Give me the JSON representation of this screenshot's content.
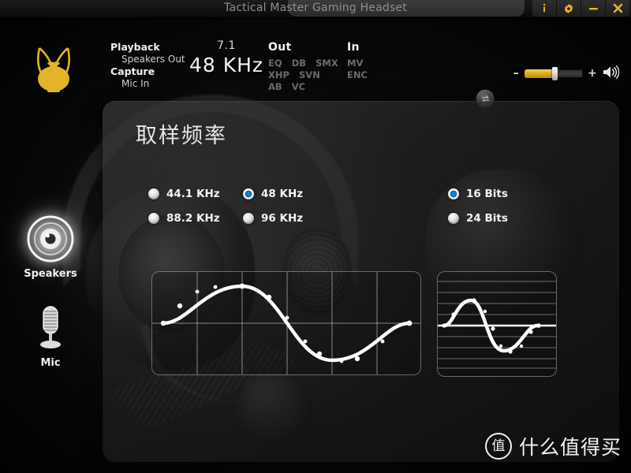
{
  "titlebar": {
    "title": "Tactical Master Gaming Headset",
    "buttons": [
      {
        "name": "info-button",
        "icon": "info-icon",
        "label": "i"
      },
      {
        "name": "settings-button",
        "icon": "gear-icon",
        "label": "⚙"
      },
      {
        "name": "minimize-button",
        "icon": "minimize-icon",
        "label": "–"
      },
      {
        "name": "close-button",
        "icon": "close-icon",
        "label": "✕"
      }
    ]
  },
  "header": {
    "logo_name": "dog-head-logo",
    "playback_label": "Playback",
    "playback_value": "Speakers Out",
    "capture_label": "Capture",
    "capture_value": "Mic In",
    "channels": "7.1",
    "sample_rate": "48  KHz",
    "out_label": "Out",
    "out_tags": [
      [
        "EQ",
        "DB",
        "SMX"
      ],
      [
        "XHP",
        "SVN"
      ],
      [
        "AB",
        "VC"
      ]
    ],
    "in_label": "In",
    "in_tags": [
      [
        "MV"
      ],
      [
        "ENC"
      ]
    ],
    "swap_icon": "swap-arrows-icon",
    "volume": {
      "minus": "–",
      "plus": "+",
      "level_percent": 52,
      "speaker_icon": "speaker-volume-icon"
    }
  },
  "rail": {
    "items": [
      {
        "name": "sidebar-item-speakers",
        "label": "Speakers",
        "icon": "speaker-icon",
        "active": true
      },
      {
        "name": "sidebar-item-mic",
        "label": "Mic",
        "icon": "microphone-icon",
        "active": false
      }
    ]
  },
  "panel": {
    "title": "取样频率",
    "sample_rates": [
      {
        "label": "44.1 KHz",
        "selected": false
      },
      {
        "label": "48 KHz",
        "selected": true
      },
      {
        "label": "88.2 KHz",
        "selected": false
      },
      {
        "label": "96 KHz",
        "selected": false
      }
    ],
    "bit_depths": [
      {
        "label": "16 Bits",
        "selected": true
      },
      {
        "label": "24 Bits",
        "selected": false
      }
    ],
    "wave_left_name": "sample-rate-waveform",
    "wave_right_name": "bit-depth-waveform"
  },
  "watermark": {
    "badge": "值",
    "text": "什么值得买"
  }
}
